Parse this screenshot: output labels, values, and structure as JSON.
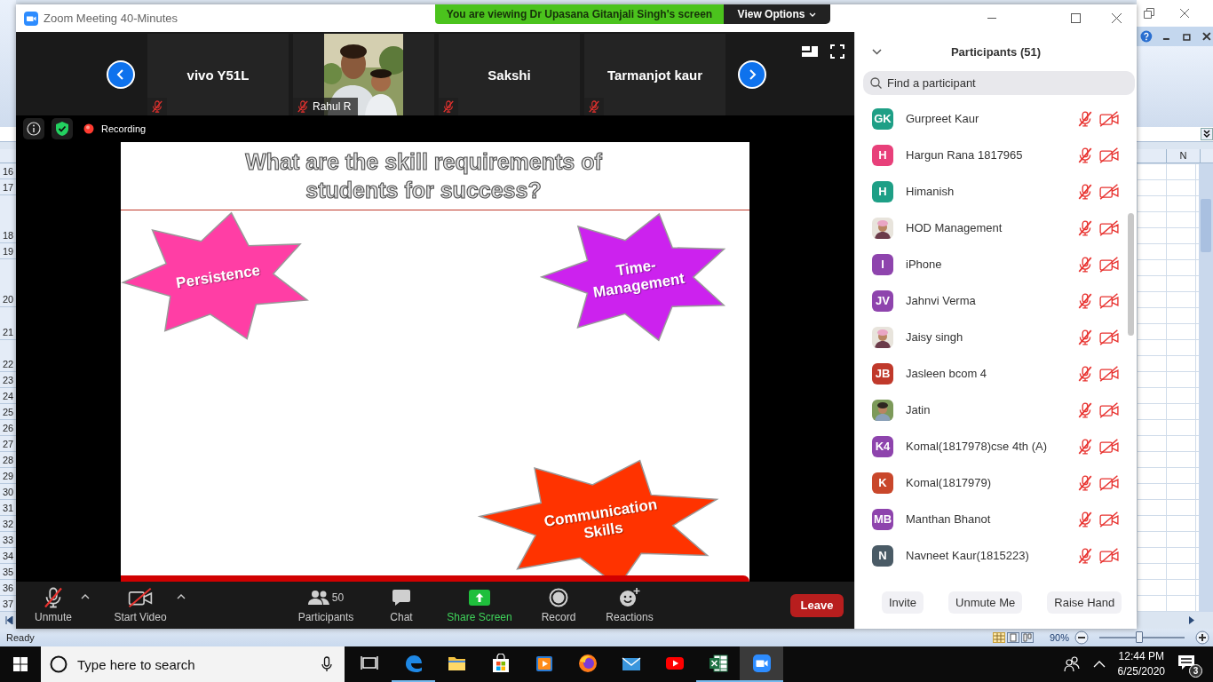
{
  "excel": {
    "row_headers": [
      "16",
      "17",
      "18",
      "19",
      "20",
      "21",
      "22",
      "23",
      "24",
      "25",
      "26",
      "27",
      "28",
      "29",
      "30",
      "31",
      "32",
      "33",
      "34",
      "35",
      "36",
      "37"
    ],
    "column_header": "N",
    "status": "Ready",
    "zoom_percent": "90%",
    "zoom_slider": {
      "level": 0.47
    }
  },
  "zoom_window": {
    "title": "Zoom Meeting 40-Minutes",
    "banner": "You are viewing Dr Upasana Gitanjali Singh's screen",
    "view_options": "View Options",
    "video_strip": [
      {
        "kind": "name",
        "name": "vivo Y51L",
        "muted": true
      },
      {
        "name": "Rahul R",
        "muted": true
      },
      {
        "kind": "name",
        "name": "Sakshi",
        "muted": true
      },
      {
        "kind": "name",
        "name": "Tarmanjot kaur",
        "muted": true
      }
    ],
    "recording": "Recording",
    "slide": {
      "title": "What are the skill requirements of students for success?",
      "stars": [
        {
          "label": "Persistence",
          "color": "#ff3ea5"
        },
        {
          "label": "Time-Management",
          "color": "#cc22ee"
        },
        {
          "label": "Communication Skills",
          "color": "#ff3300"
        }
      ]
    },
    "toolbar": [
      {
        "kind": "audio",
        "label": "Unmute",
        "off": true
      },
      {
        "kind": "video",
        "label": "Start Video",
        "off": true
      },
      {
        "kind": "participants",
        "label": "Participants",
        "count": "50"
      },
      {
        "kind": "chat",
        "label": "Chat"
      },
      {
        "kind": "share",
        "label": "Share Screen"
      },
      {
        "kind": "record",
        "label": "Record"
      },
      {
        "kind": "reactions",
        "label": "Reactions"
      }
    ],
    "leave": "Leave"
  },
  "participants_panel": {
    "title": "Participants (51)",
    "search": {
      "placeholder": "Find a participant"
    },
    "participants": [
      {
        "kind": "initials",
        "initials": "GK",
        "color": "#1e9f86",
        "name": "Gurpreet Kaur",
        "muted": true,
        "video_off": true
      },
      {
        "kind": "initials",
        "initials": "H",
        "color": "#e8407a",
        "name": "Hargun Rana 1817965",
        "muted": true,
        "video_off": true
      },
      {
        "kind": "initials",
        "initials": "H",
        "color": "#1e9f86",
        "name": "Himanish",
        "muted": true,
        "video_off": true
      },
      {
        "name": "HOD Management",
        "muted": true,
        "video_off": true
      },
      {
        "kind": "initials",
        "initials": "I",
        "color": "#8e44ad",
        "name": "iPhone",
        "muted": true,
        "video_off": true
      },
      {
        "kind": "initials",
        "initials": "JV",
        "color": "#8e44ad",
        "name": "Jahnvi Verma",
        "muted": true,
        "video_off": true
      },
      {
        "name": "Jaisy singh",
        "muted": true,
        "video_off": true
      },
      {
        "kind": "initials",
        "initials": "JB",
        "color": "#c0392b",
        "name": "Jasleen bcom 4",
        "muted": true,
        "video_off": true
      },
      {
        "name": "Jatin",
        "muted": true,
        "video_off": true
      },
      {
        "kind": "initials",
        "initials": "K4",
        "color": "#8e44ad",
        "name": "Komal(1817978)cse 4th (A)",
        "muted": true,
        "video_off": true
      },
      {
        "kind": "initials",
        "initials": "K",
        "color": "#c9472b",
        "name": "Komal(1817979)",
        "muted": true,
        "video_off": true
      },
      {
        "kind": "initials",
        "initials": "MB",
        "color": "#8e44ad",
        "name": "Manthan Bhanot",
        "muted": true,
        "video_off": true
      },
      {
        "kind": "initials",
        "initials": "N",
        "color": "#4a5b66",
        "name": "Navneet Kaur(1815223)",
        "muted": true,
        "video_off": true
      }
    ],
    "buttons": [
      "Invite",
      "Unmute Me",
      "Raise Hand"
    ]
  },
  "taskbar": {
    "search": {
      "placeholder": "Type here to search"
    },
    "apps": [
      {
        "kind": "task-view",
        "running": false,
        "active": false
      },
      {
        "kind": "edge",
        "running": true,
        "active": false
      },
      {
        "kind": "explorer",
        "running": false,
        "active": false
      },
      {
        "kind": "store",
        "running": false,
        "active": false
      },
      {
        "kind": "media",
        "running": false,
        "active": false
      },
      {
        "kind": "firefox",
        "running": false,
        "active": false
      },
      {
        "kind": "mail",
        "running": false,
        "active": false
      },
      {
        "kind": "youtube",
        "running": false,
        "active": false
      },
      {
        "kind": "excel",
        "running": true,
        "active": false
      },
      {
        "kind": "zoom",
        "running": true,
        "active": true
      }
    ],
    "time": "12:44 PM",
    "date": "6/25/2020",
    "notifications": "3"
  }
}
